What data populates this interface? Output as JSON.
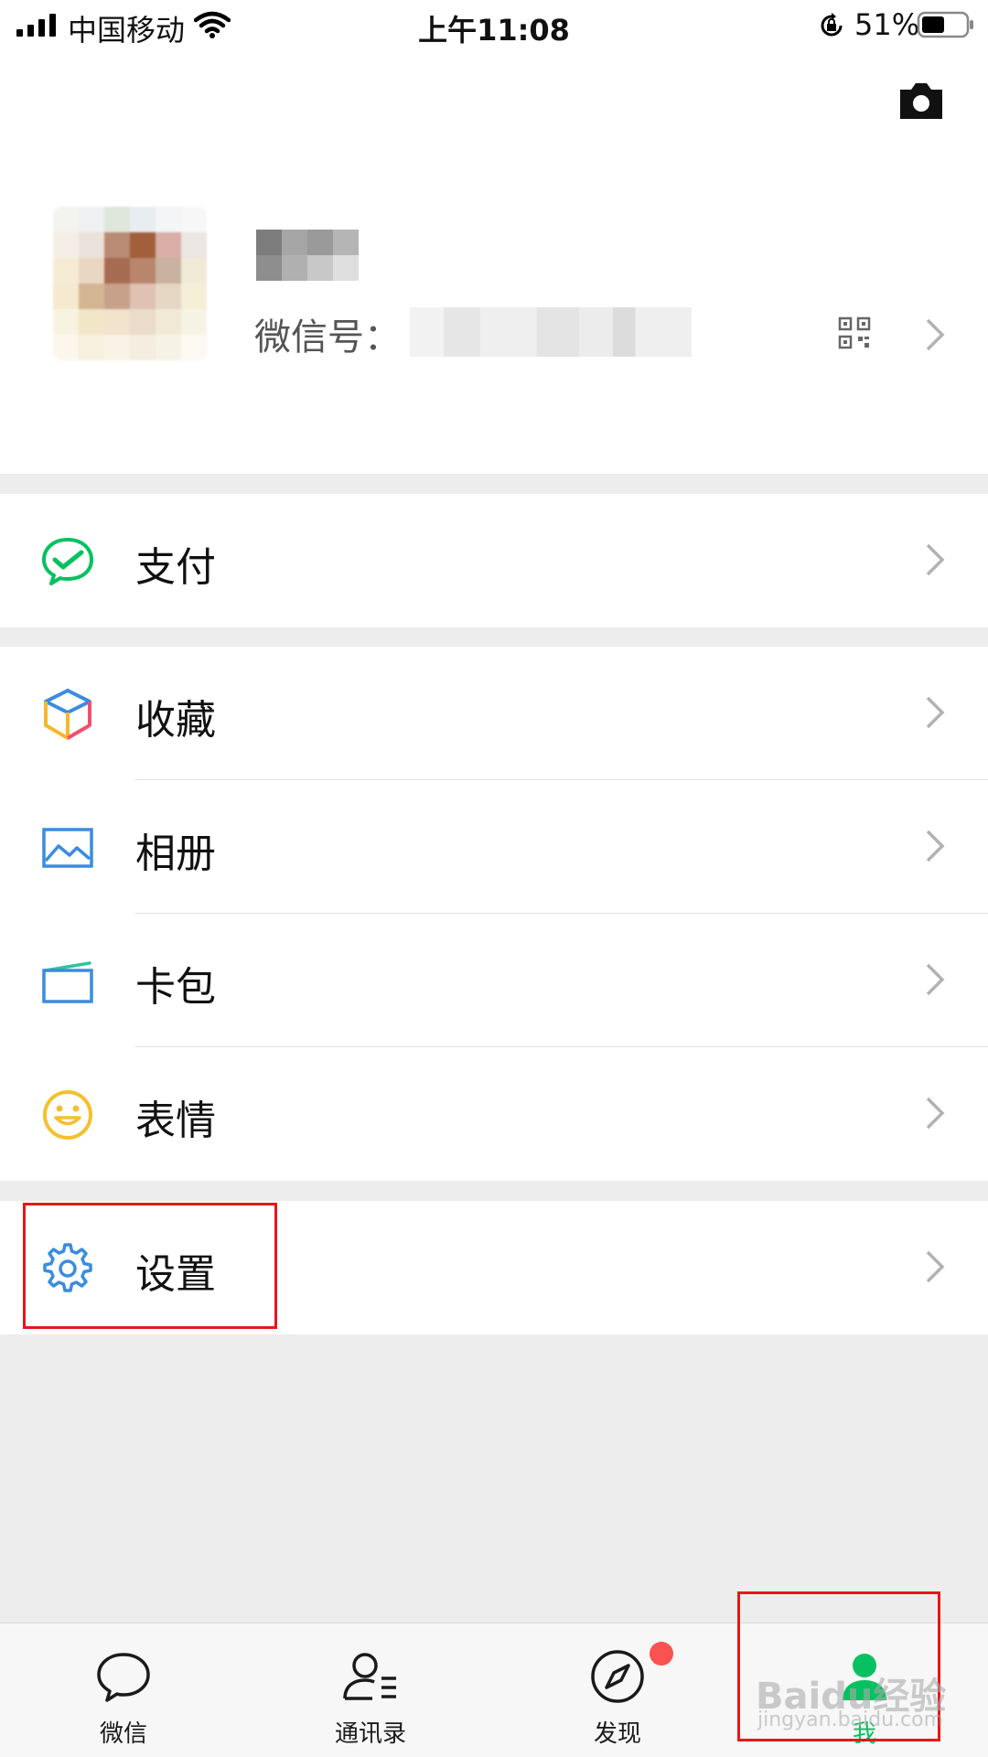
{
  "status_bar": {
    "carrier": "中国移动",
    "time": "上午11:08",
    "battery": "51%"
  },
  "profile": {
    "wechat_id_label": "微信号："
  },
  "menu": {
    "pay": "支付",
    "favorites": "收藏",
    "album": "相册",
    "cards": "卡包",
    "stickers": "表情",
    "settings": "设置"
  },
  "tabs": [
    {
      "label": "微信",
      "icon": "chat-bubble-icon"
    },
    {
      "label": "通讯录",
      "icon": "contacts-icon"
    },
    {
      "label": "发现",
      "icon": "compass-icon",
      "badge": true
    },
    {
      "label": "我",
      "icon": "person-icon",
      "active": true
    }
  ],
  "watermark": {
    "brand": "Baidu经验",
    "site": "jingyan.baidu.com"
  },
  "colors": {
    "accent": "#07c160",
    "highlight_box": "#e8161a",
    "badge": "#fa5151"
  }
}
